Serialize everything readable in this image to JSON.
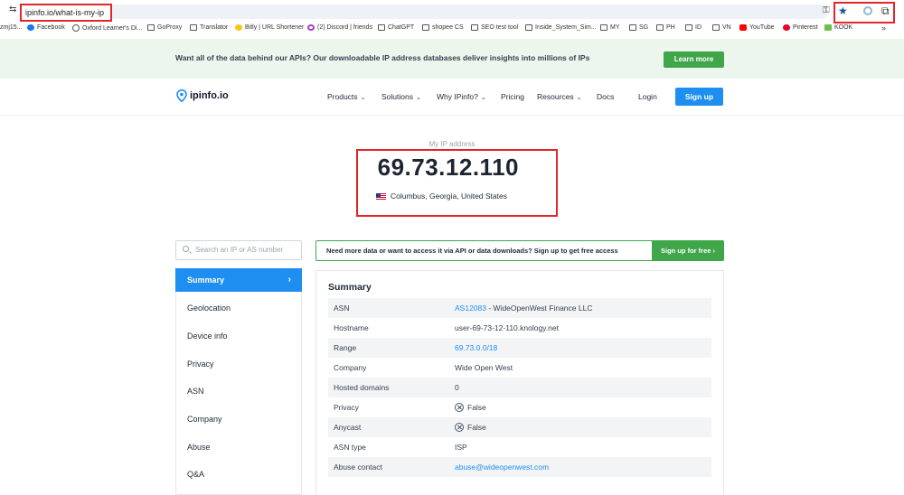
{
  "browser": {
    "url": "ipinfo.io/what-is-my-ip",
    "bookmarks": [
      {
        "label": "zmj15...",
        "icon": "none"
      },
      {
        "label": "Facebook",
        "icon": "facebook-icon"
      },
      {
        "label": "Oxford Learner's Di...",
        "icon": "site-icon"
      },
      {
        "label": "GoProxy",
        "icon": "folder-icon"
      },
      {
        "label": "Translator",
        "icon": "folder-icon"
      },
      {
        "label": "Bitly | URL Shortener",
        "icon": "bitly-icon"
      },
      {
        "label": "(2) Discord | friends",
        "icon": "discord-icon"
      },
      {
        "label": "ChatGPT",
        "icon": "folder-icon"
      },
      {
        "label": "shopee CS",
        "icon": "folder-icon"
      },
      {
        "label": "SEO test tool",
        "icon": "folder-icon"
      },
      {
        "label": "Inside_System_Sim...",
        "icon": "folder-icon"
      },
      {
        "label": "MY",
        "icon": "folder-icon"
      },
      {
        "label": "SG",
        "icon": "folder-icon"
      },
      {
        "label": "PH",
        "icon": "folder-icon"
      },
      {
        "label": "ID",
        "icon": "folder-icon"
      },
      {
        "label": "VN",
        "icon": "folder-icon"
      },
      {
        "label": "YouTube",
        "icon": "youtube-icon"
      },
      {
        "label": "Pinterest",
        "icon": "pinterest-icon"
      },
      {
        "label": "KOOK",
        "icon": "kook-icon"
      }
    ]
  },
  "promo": {
    "text": "Want all of the data behind our APIs? Our downloadable IP address databases deliver insights into millions of IPs",
    "button": "Learn more"
  },
  "nav": {
    "logo": "ipinfo.io",
    "items": [
      {
        "label": "Products",
        "dropdown": true
      },
      {
        "label": "Solutions",
        "dropdown": true
      },
      {
        "label": "Why IPinfo?",
        "dropdown": true
      },
      {
        "label": "Pricing",
        "dropdown": false
      },
      {
        "label": "Resources",
        "dropdown": true
      },
      {
        "label": "Docs",
        "dropdown": false
      }
    ],
    "login": "Login",
    "signup": "Sign up"
  },
  "hero": {
    "label": "My IP address",
    "ip": "69.73.12.110",
    "location": "Columbus, Georgia, United States"
  },
  "sidebar": {
    "search_placeholder": "Search an IP or AS number",
    "items": [
      {
        "label": "Summary",
        "active": true
      },
      {
        "label": "Geolocation",
        "active": false
      },
      {
        "label": "Device info",
        "active": false
      },
      {
        "label": "Privacy",
        "active": false
      },
      {
        "label": "ASN",
        "active": false
      },
      {
        "label": "Company",
        "active": false
      },
      {
        "label": "Abuse",
        "active": false
      },
      {
        "label": "Q&A",
        "active": false
      }
    ]
  },
  "cta": {
    "text": "Need more data or want to access it via API or data downloads? Sign up to get free access",
    "button": "Sign up for free ›"
  },
  "summary": {
    "title": "Summary",
    "rows": [
      {
        "key": "ASN",
        "link": "AS12083",
        "text": " - WideOpenWest Finance LLC"
      },
      {
        "key": "Hostname",
        "text": "user-69-73-12-110.knology.net"
      },
      {
        "key": "Range",
        "link": "69.73.0.0/18"
      },
      {
        "key": "Company",
        "text": "Wide Open West"
      },
      {
        "key": "Hosted domains",
        "text": "0"
      },
      {
        "key": "Privacy",
        "text": "False",
        "xicon": true
      },
      {
        "key": "Anycast",
        "text": "False",
        "xicon": true
      },
      {
        "key": "ASN type",
        "text": "ISP"
      },
      {
        "key": "Abuse contact",
        "link": "abuse@wideopenwest.com"
      }
    ]
  },
  "colors": {
    "accent_blue": "#1f8ef1",
    "accent_green": "#3fa74a",
    "highlight_red": "#e3262b"
  }
}
